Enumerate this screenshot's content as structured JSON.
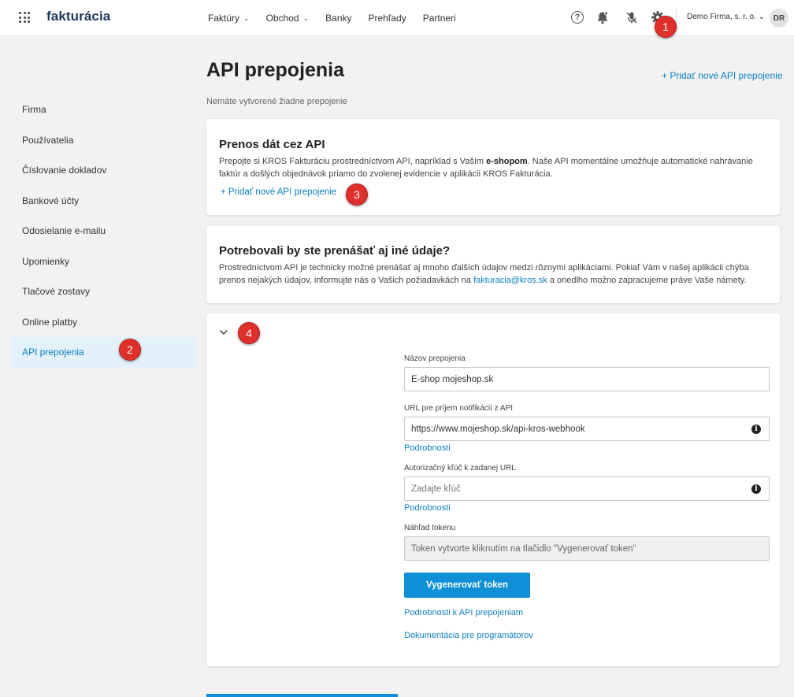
{
  "topbar": {
    "logo": "fakturácia",
    "nav": [
      {
        "label": "Faktúry",
        "dropdown": true
      },
      {
        "label": "Obchod",
        "dropdown": true
      },
      {
        "label": "Banky",
        "dropdown": false
      },
      {
        "label": "Prehľady",
        "dropdown": false
      },
      {
        "label": "Partneri",
        "dropdown": false
      }
    ],
    "company": "Demo Firma, s. r. o.",
    "company_chevron": "⌄",
    "avatar_initials": "DR",
    "help_glyph": "?",
    "icons": [
      "apps-grid-icon",
      "help-icon",
      "bell-icon",
      "mic-off-icon",
      "gear-icon"
    ]
  },
  "badges": [
    "1",
    "2",
    "3",
    "4"
  ],
  "sidebar": {
    "items": [
      {
        "label": "Firma",
        "active": false
      },
      {
        "label": "Používatelia",
        "active": false
      },
      {
        "label": "Číslovanie dokladov",
        "active": false
      },
      {
        "label": "Bankové účty",
        "active": false
      },
      {
        "label": "Odosielanie e-mailu",
        "active": false
      },
      {
        "label": "Upomienky",
        "active": false
      },
      {
        "label": "Tlačové zostavy",
        "active": false
      },
      {
        "label": "Online platby",
        "active": false
      },
      {
        "label": "API prepojenia",
        "active": true
      }
    ]
  },
  "main": {
    "title": "API prepojenia",
    "add_link_top": "+ Pridať nové API prepojenie",
    "subtitle": "Nemáte vytvorené žiadne prepojenie",
    "card1": {
      "title": "Prenos dát cez API",
      "text_before": "Prepojte si KROS Fakturáciu prostredníctvom API, napríklad s Vaším ",
      "text_bold": "e-shopom",
      "text_after": ". Naše API momentálne umožňuje automatické nahrávanie faktúr a došlých objednávok priamo do zvolenej evidencie v aplikácii KROS Fakturácia.",
      "add_link": "+ Pridať nové API prepojenie"
    },
    "card2": {
      "title": "Potrebovali by ste prenášať aj iné údaje?",
      "text_before": "Prostredníctvom API je technicky možné prenášať aj mnoho ďalších údajov medzi rôznymi aplikáciami. Pokiaľ Vám v našej aplikácii chýba prenos nejakých údajov, informujte nás o Vašich požiadavkách na ",
      "email": "fakturacia@kros.sk",
      "text_after": " a onedlho možno zapracujeme práve Vaše námety."
    },
    "form": {
      "collapse_glyph": "⌄",
      "info_glyph": "i",
      "name_label": "Názov prepojenia",
      "name_value": "E-shop mojeshop.sk",
      "url_label": "URL pre príjem notifikácií z API",
      "url_value": "https://www.mojeshop.sk/api-kros-webhook",
      "details_1": "Podrobnosti",
      "key_label": "Autorizačný kľúč k zadanej URL",
      "key_placeholder": "Zadajte kľúč",
      "details_2": "Podrobnosti",
      "token_label": "Náhľad tokenu",
      "token_placeholder": "Token vytvorte kliknutím na tlačidlo \"Vygenerovať token\"",
      "generate_button": "Vygenerovať token",
      "details_api_link": "Podrobnosti k API prepojeniam",
      "docs_link": "Dokumentácia pre programátorov"
    }
  }
}
